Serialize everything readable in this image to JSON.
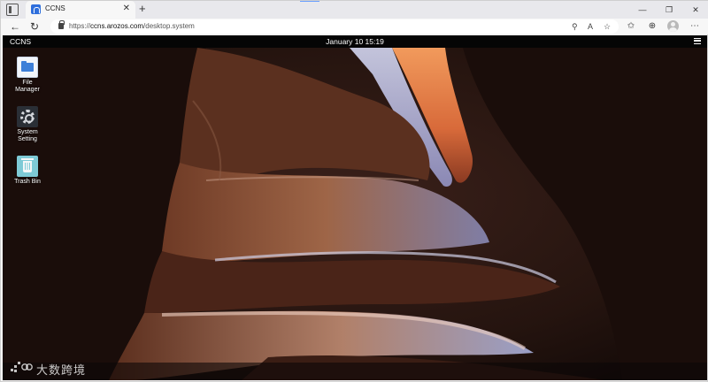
{
  "browser": {
    "tab": {
      "title": "CCNS"
    },
    "address": {
      "scheme": "https://",
      "host": "ccns.arozos.com",
      "path": "/desktop.system"
    }
  },
  "desktop": {
    "brand": "CCNS",
    "clock": "January 10 15:19",
    "icons": [
      {
        "label": "File\nManager",
        "icon": "folder-icon"
      },
      {
        "label": "System\nSetting",
        "icon": "gear-icon"
      },
      {
        "label": "Trash Bin",
        "icon": "trash-icon"
      }
    ]
  },
  "watermark": {
    "text": "大数跨境"
  },
  "colors": {
    "topbar": "#050505",
    "accent": "#2f6fdc",
    "canyon_light": "#e8835a"
  }
}
